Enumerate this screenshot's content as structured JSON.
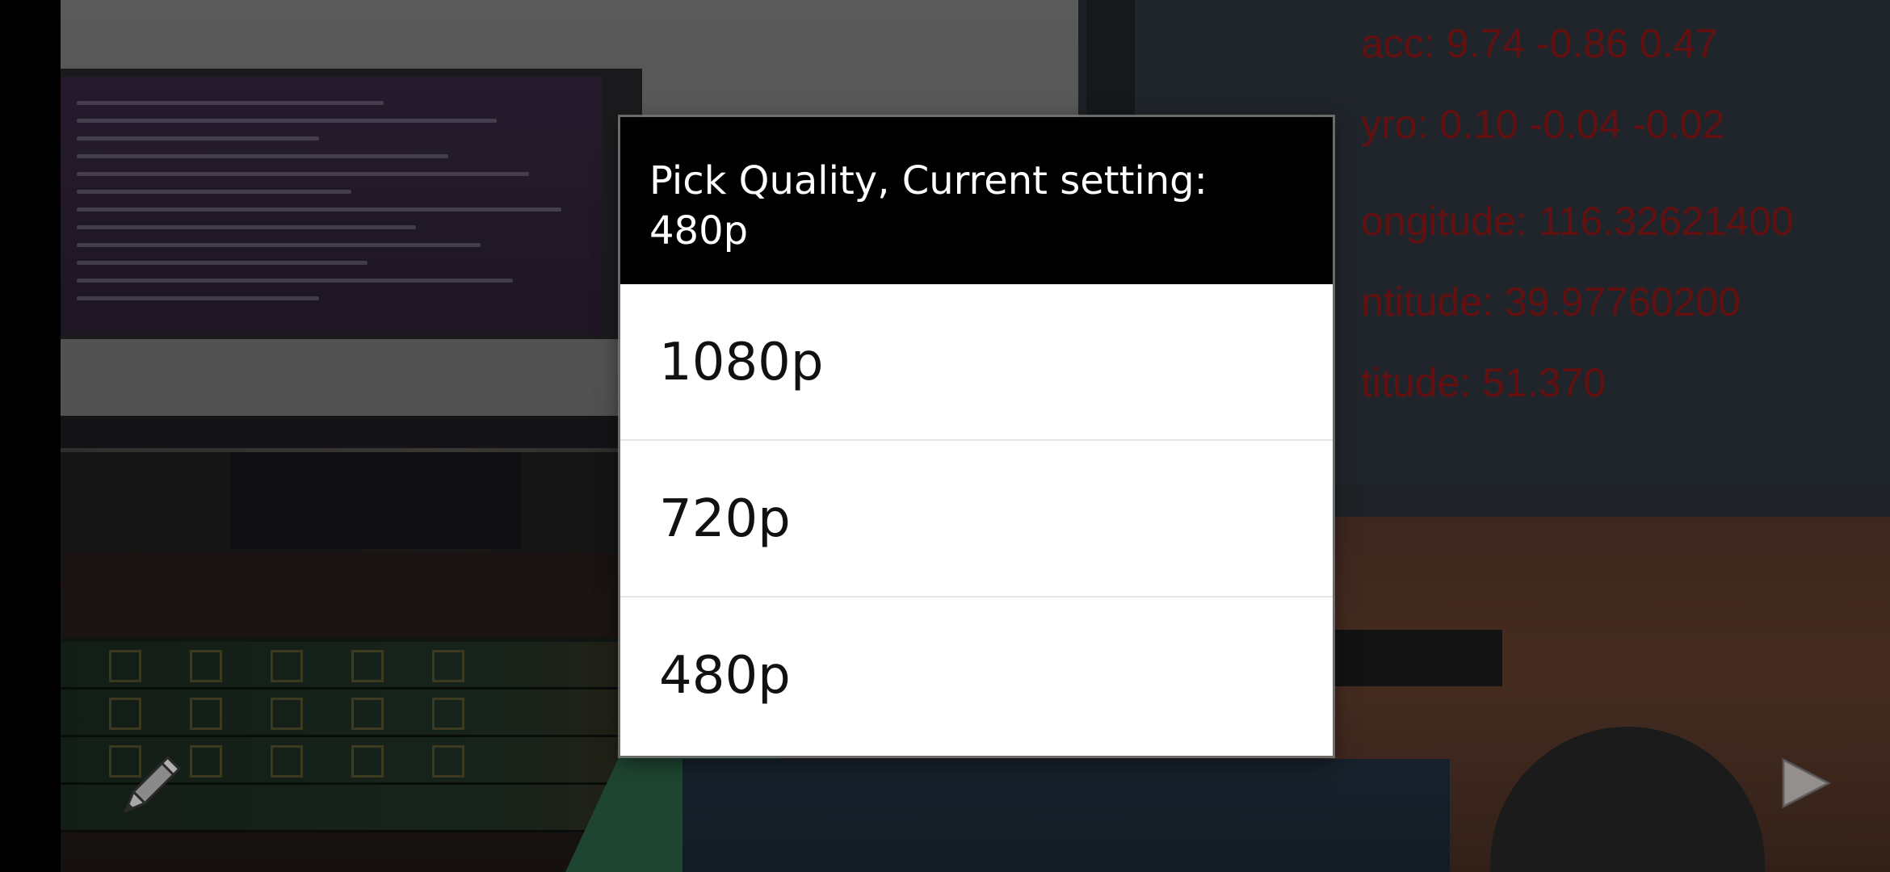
{
  "dialog": {
    "title": "Pick Quality, Current setting:\n480p",
    "title_line1": "Pick Quality, Current setting:",
    "title_line2": "480p",
    "options": [
      {
        "label": "1080p"
      },
      {
        "label": "720p"
      },
      {
        "label": "480p"
      }
    ]
  },
  "sensor_overlay": {
    "acc": "acc: 9.74 -0.86 0.47",
    "gyro": "yro: 0.10 -0.04 -0.02",
    "longitude": "ongitude: 116.32621400",
    "latitude": "ntitude: 39.97760200",
    "altitude": "titude: 51.370",
    "text_color": "#aa1414"
  },
  "controls": {
    "edit_icon": "pencil-icon",
    "play_icon": "play-triangle-icon"
  },
  "colors": {
    "dialog_header_bg": "#000000",
    "dialog_body_bg": "#ffffff",
    "divider": "#e6e6e6"
  }
}
